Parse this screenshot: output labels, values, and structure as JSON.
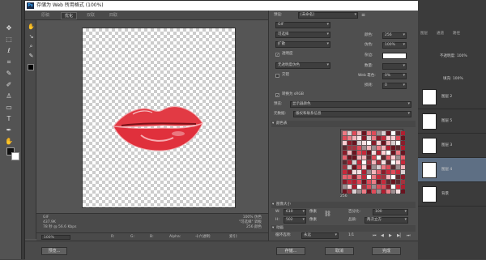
{
  "dialog_title": "存储为 Web 所用格式 (100%)",
  "preview_tabs": [
    "原稿",
    "优化",
    "双联",
    "四联"
  ],
  "active_tab": "优化",
  "preview_info_left": [
    "GIF",
    "437.9K",
    "78 秒 @ 56.6 Kbps"
  ],
  "preview_info_right": [
    "100% 仿色",
    "\"可选择\" 调板",
    "256 颜色"
  ],
  "zoom_label": "100%",
  "status": {
    "r": "R:",
    "g": "G:",
    "b": "B:",
    "alpha": "Alpha:",
    "hex": "十六进制:",
    "index": "索引:"
  },
  "settings": {
    "preset_label": "预设:",
    "preset_value": "[未命名]",
    "format": "GIF",
    "reduction": "可选择",
    "dither_algo": "扩散",
    "colors_label": "颜色:",
    "colors_value": "256",
    "dither_label": "仿色:",
    "dither_value": "100%",
    "transparency_label": "透明度",
    "matte_label": "杂边:",
    "transparency_dither": "无透明度仿色",
    "amount_label": "数量:",
    "interlaced_label": "交错",
    "web_snap_label": "Web 靠色:",
    "web_snap_value": "0%",
    "lossy_label": "损耗:",
    "lossy_value": "0",
    "convert_srgb": "转换为 sRGB",
    "preview_label": "预览:",
    "preview_value": "显示器颜色",
    "metadata_label": "元数据:",
    "metadata_value": "版权和联系信息",
    "color_table_label": "颜色表",
    "color_count": "256",
    "image_size_label": "图像大小",
    "width_label": "W:",
    "width_value": "610",
    "height_label": "H:",
    "height_value": "502",
    "pixels_label": "像素",
    "percent_label": "百分比:",
    "percent_value": "100",
    "quality_label": "品质:",
    "quality_value": "两次立方",
    "animation_label": "动画",
    "loop_label": "循环选项:",
    "loop_value": "永远",
    "frame_counter": "1/1"
  },
  "buttons": {
    "preview": "预览...",
    "save": "存储...",
    "cancel": "取消",
    "done": "完成"
  },
  "layers": {
    "tabs": [
      "图层",
      "通道",
      "路径"
    ],
    "opacity_label": "不透明度: 100%",
    "fill_label": "填充: 100%",
    "items": [
      "图层 2",
      "图层 5",
      "图层 3",
      "图层 4",
      "背景"
    ]
  },
  "colors": {
    "lips_red": "#e23a44",
    "accent": "#31a8ff"
  }
}
